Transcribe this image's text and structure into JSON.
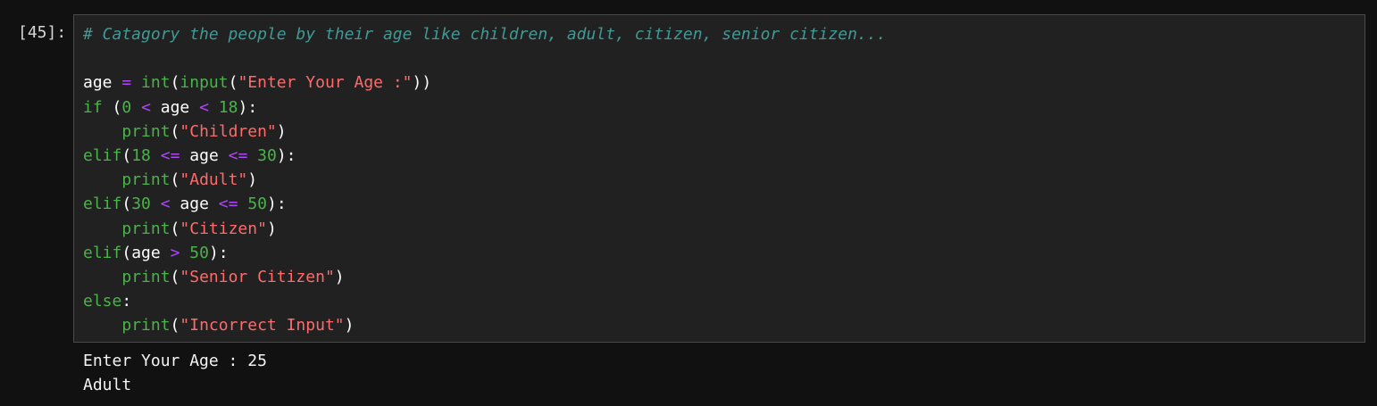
{
  "cell": {
    "prompt": "[45]:"
  },
  "code": {
    "comment": "# Catagory the people by their age like children, adult, citizen, senior citizen...",
    "l3": {
      "var": "age",
      "op": "=",
      "fn": "int",
      "p1": "(",
      "fn2": "input",
      "p2": "(",
      "str": "\"Enter Your Age :\"",
      "p3": "))"
    },
    "l4": {
      "kw": "if",
      "p1": "(",
      "n1": "0",
      "op1": "<",
      "var": "age",
      "op2": "<",
      "n2": "18",
      "p2": "):"
    },
    "l5": {
      "indent": "    ",
      "fn": "print",
      "p1": "(",
      "str": "\"Children\"",
      "p2": ")"
    },
    "l6": {
      "kw": "elif",
      "p1": "(",
      "n1": "18",
      "op1": "<=",
      "var": "age",
      "op2": "<=",
      "n2": "30",
      "p2": "):"
    },
    "l7": {
      "indent": "    ",
      "fn": "print",
      "p1": "(",
      "str": "\"Adult\"",
      "p2": ")"
    },
    "l8": {
      "kw": "elif",
      "p1": "(",
      "n1": "30",
      "op1": "<",
      "var": "age",
      "op2": "<=",
      "n2": "50",
      "p2": "):"
    },
    "l9": {
      "indent": "    ",
      "fn": "print",
      "p1": "(",
      "str": "\"Citizen\"",
      "p2": ")"
    },
    "l10": {
      "kw": "elif",
      "p1": "(",
      "var": "age",
      "op1": ">",
      "n1": "50",
      "p2": "):"
    },
    "l11": {
      "indent": "    ",
      "fn": "print",
      "p1": "(",
      "str": "\"Senior Citizen\"",
      "p2": ")"
    },
    "l12": {
      "kw": "else",
      "p1": ":"
    },
    "l13": {
      "indent": "    ",
      "fn": "print",
      "p1": "(",
      "str": "\"Incorrect Input\"",
      "p2": ")"
    }
  },
  "output": {
    "lines": [
      "Enter Your Age : 25",
      "Adult"
    ]
  },
  "colors": {
    "background": "#111111",
    "editor_background": "#212121",
    "editor_border": "#4a4a4a",
    "comment": "#3f9a96",
    "keyword": "#4ab34a",
    "operator": "#b144ff",
    "string": "#ff6b6b",
    "text": "#ffffff"
  }
}
